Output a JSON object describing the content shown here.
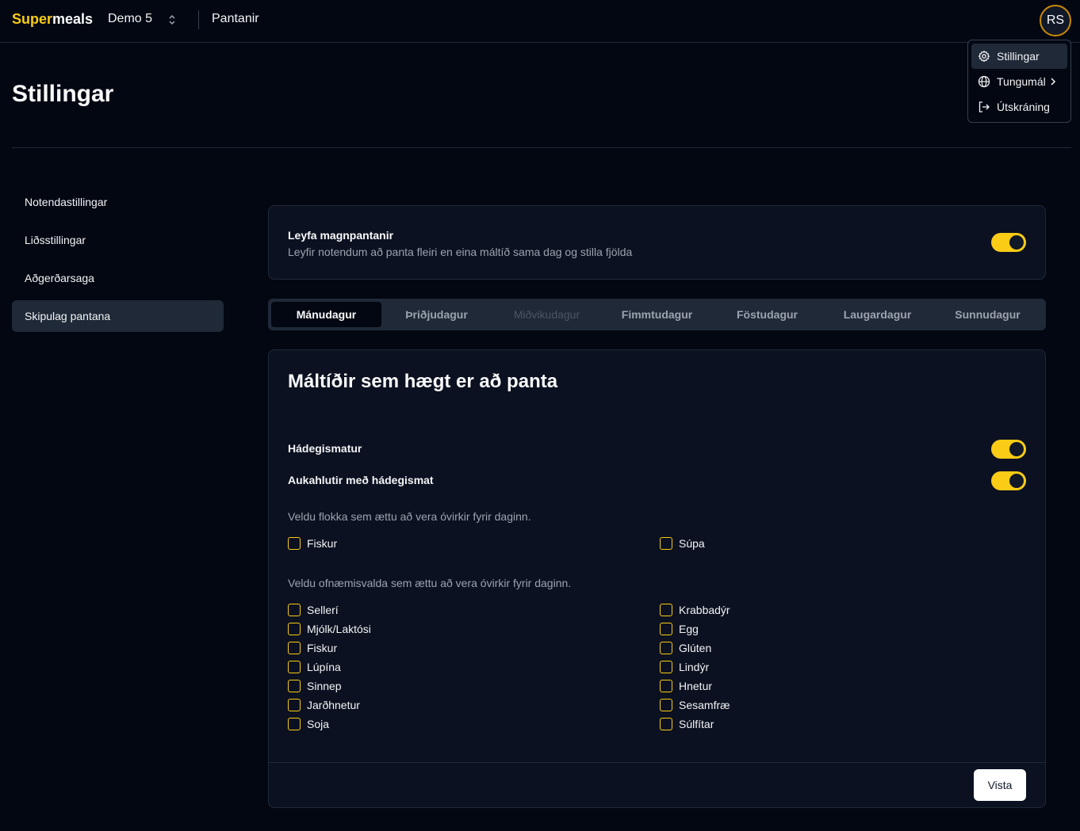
{
  "header": {
    "brand_accent": "Super",
    "brand_rest": "meals",
    "team": "Demo 5",
    "nav_link": "Pantanir",
    "avatar_initials": "RS"
  },
  "user_menu": {
    "items": [
      {
        "label": "Stillingar",
        "icon": "gear-icon"
      },
      {
        "label": "Tungumál",
        "icon": "globe-icon"
      },
      {
        "label": "Útskráning",
        "icon": "logout-icon"
      }
    ]
  },
  "page": {
    "title": "Stillingar"
  },
  "sidebar": {
    "items": [
      {
        "label": "Notendastillingar"
      },
      {
        "label": "Liðsstillingar"
      },
      {
        "label": "Aðgerðarsaga"
      },
      {
        "label": "Skipulag pantana"
      }
    ],
    "active": "Skipulag pantana"
  },
  "bulk": {
    "title": "Leyfa magnpantanir",
    "description": "Leyfir notendum að panta fleiri en eina máltíð sama dag og stilla fjölda",
    "enabled": true
  },
  "days": {
    "tabs": [
      {
        "label": "Mánudagur",
        "state": "active"
      },
      {
        "label": "Þriðjudagur",
        "state": "normal"
      },
      {
        "label": "Miðvikudagur",
        "state": "disabled"
      },
      {
        "label": "Fimmtudagur",
        "state": "normal"
      },
      {
        "label": "Föstudagur",
        "state": "normal"
      },
      {
        "label": "Laugardagur",
        "state": "normal"
      },
      {
        "label": "Sunnudagur",
        "state": "normal"
      }
    ]
  },
  "meals": {
    "title": "Máltíðir sem hægt er að panta",
    "lunch_label": "Hádegismatur",
    "lunch_enabled": true,
    "sides_label": "Aukahlutir með hádegismat",
    "sides_enabled": true,
    "categories_hint": "Veldu flokka sem ættu að vera óvirkir fyrir daginn.",
    "categories": [
      "Fiskur",
      "Súpa"
    ],
    "allergens_hint": "Veldu ofnæmisvalda sem ættu að vera óvirkir fyrir daginn.",
    "allergens_left": [
      "Sellerí",
      "Mjólk/Laktósi",
      "Fiskur",
      "Lúpína",
      "Sinnep",
      "Jarðhnetur",
      "Soja"
    ],
    "allergens_right": [
      "Krabbadýr",
      "Egg",
      "Glúten",
      "Lindýr",
      "Hnetur",
      "Sesamfræ",
      "Súlfítar"
    ],
    "save_label": "Vista"
  },
  "colors": {
    "accent": "#facc15",
    "background": "#030712",
    "card": "#0b1120",
    "border": "#1f2937"
  }
}
